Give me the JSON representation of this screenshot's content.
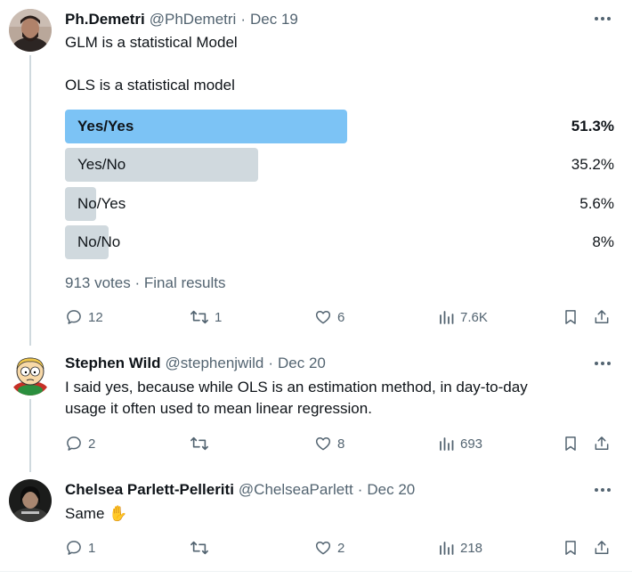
{
  "tweets": [
    {
      "author": "Ph.Demetri",
      "handle": "@PhDemetri",
      "sep": "·",
      "date": "Dec 19",
      "text_lines": [
        "GLM is a statistical Model",
        "OLS is a statistical model"
      ],
      "poll": {
        "options": [
          {
            "label": "Yes/Yes",
            "percent": "51.3%",
            "value": 51.3,
            "color": "#7cc3f5",
            "winner": true
          },
          {
            "label": "Yes/No",
            "percent": "35.2%",
            "value": 35.2,
            "color": "#d0d9de",
            "winner": false
          },
          {
            "label": "No/Yes",
            "percent": "5.6%",
            "value": 5.6,
            "color": "#d0d9de",
            "winner": false
          },
          {
            "label": "No/No",
            "percent": "8%",
            "value": 8,
            "color": "#d0d9de",
            "winner": false
          }
        ],
        "votes": "913 votes",
        "status": "Final results"
      },
      "actions": {
        "replies": "12",
        "retweets": "1",
        "likes": "6",
        "views": "7.6K"
      }
    },
    {
      "author": "Stephen Wild",
      "handle": "@stephenjwild",
      "sep": "·",
      "date": "Dec 20",
      "text_lines": [
        "I said yes, because while OLS is an estimation method, in day-to-day",
        "usage it often used to mean linear regression."
      ],
      "actions": {
        "replies": "2",
        "retweets": "",
        "likes": "8",
        "views": "693"
      }
    },
    {
      "author": "Chelsea Parlett-Pelleriti",
      "handle": "@ChelseaParlett",
      "sep": "·",
      "date": "Dec 20",
      "text_lines": [
        "Same ✋"
      ],
      "actions": {
        "replies": "1",
        "retweets": "",
        "likes": "2",
        "views": "218"
      }
    }
  ],
  "colors": {
    "text": "#0f1419",
    "muted": "#536471",
    "accent": "#1d9bf0",
    "winner_bar": "#7cc3f5",
    "bar": "#d0d9de"
  }
}
